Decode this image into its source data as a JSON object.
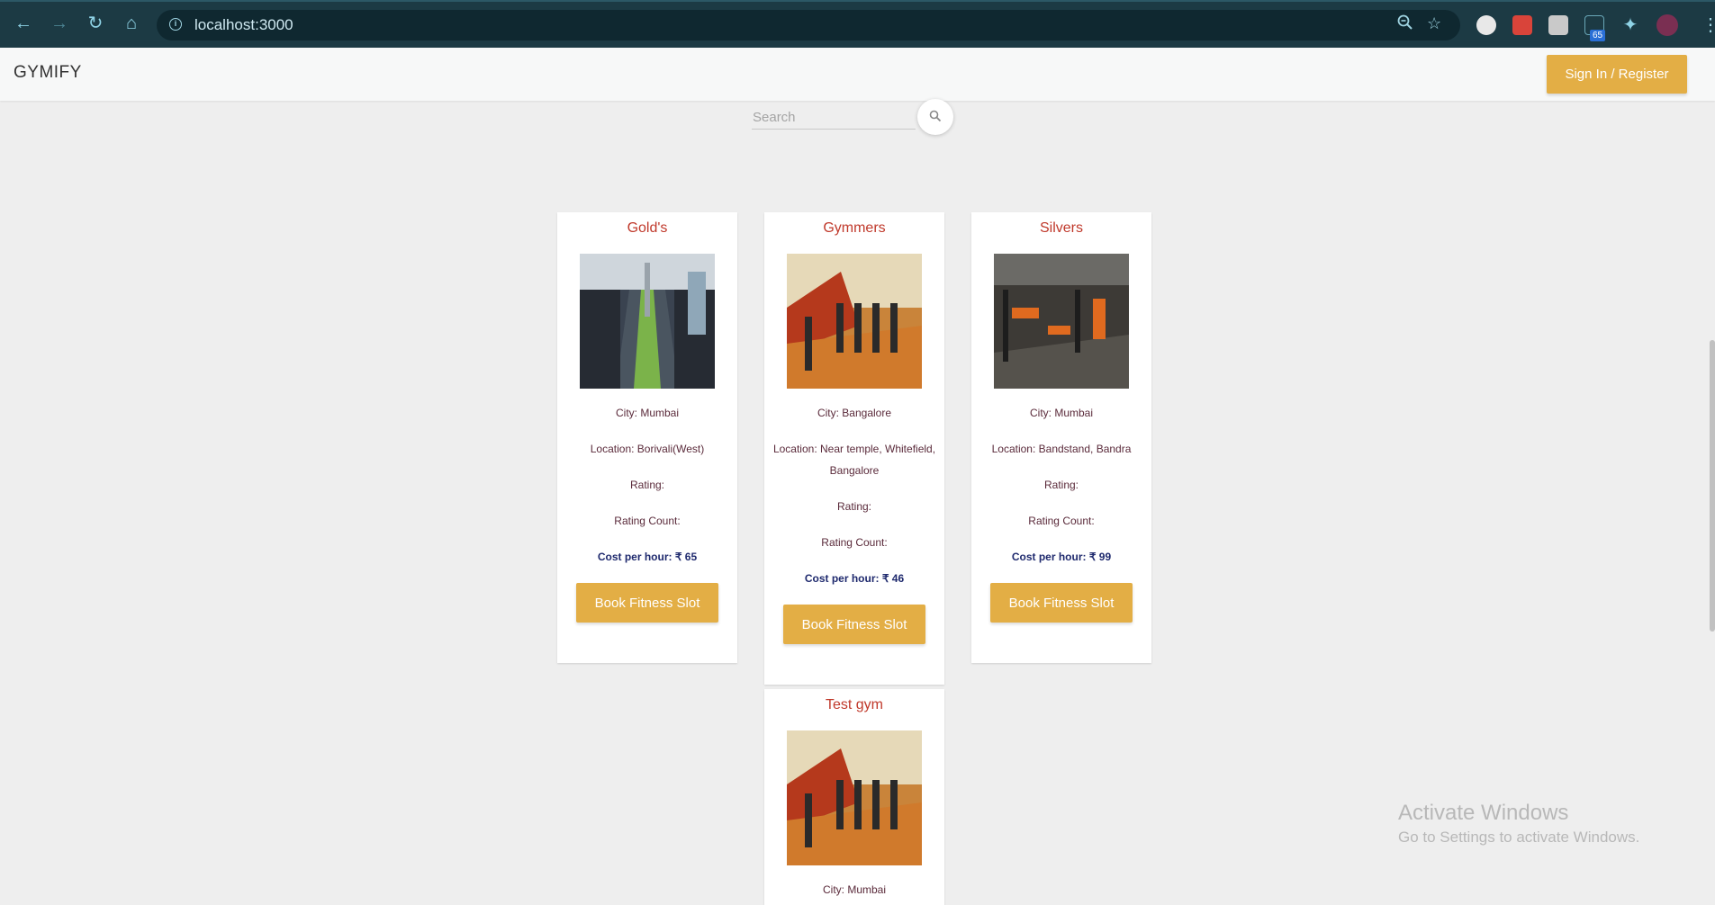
{
  "browser": {
    "url": "localhost:3000",
    "extension_badge": "65",
    "icons": [
      "back-icon",
      "forward-icon",
      "reload-icon",
      "home-icon",
      "info-icon",
      "zoom-icon",
      "star-icon",
      "extensions-icon",
      "profile-avatar",
      "menu-icon"
    ]
  },
  "header": {
    "brand": "GYMIFY",
    "signin_label": "Sign In / Register"
  },
  "search": {
    "placeholder": "Search",
    "value": ""
  },
  "gyms": [
    {
      "name": "Gold's",
      "city_label": "City: Mumbai",
      "location_label": "Location: Borivali(West)",
      "rating_label": "Rating:",
      "rating_count_label": "Rating Count:",
      "cost_prefix": "Cost per hour: ",
      "cost_value": "₹ 65",
      "button_label": "Book Fitness Slot"
    },
    {
      "name": "Gymmers",
      "city_label": "City: Bangalore",
      "location_label": "Location: Near temple, Whitefield, Bangalore",
      "rating_label": "Rating:",
      "rating_count_label": "Rating Count:",
      "cost_prefix": "Cost per hour: ",
      "cost_value": "₹ 46",
      "button_label": "Book Fitness Slot"
    },
    {
      "name": "Silvers",
      "city_label": "City: Mumbai",
      "location_label": "Location: Bandstand, Bandra",
      "rating_label": "Rating:",
      "rating_count_label": "Rating Count:",
      "cost_prefix": "Cost per hour: ",
      "cost_value": "₹ 99",
      "button_label": "Book Fitness Slot"
    },
    {
      "name": "Test gym",
      "city_label": "City: Mumbai"
    }
  ],
  "colors": {
    "chrome": "#1c3a44",
    "accent": "#e3ae45",
    "gym_name": "#c0392b",
    "background": "#eeeeee"
  },
  "watermark": {
    "title": "Activate Windows",
    "subtitle": "Go to Settings to activate Windows."
  }
}
